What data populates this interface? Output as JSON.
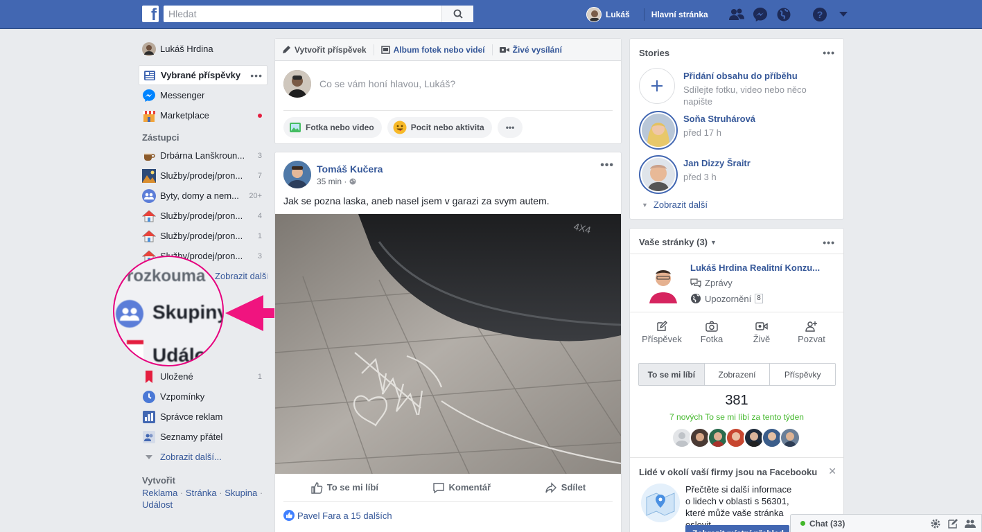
{
  "topbar": {
    "logo": "f",
    "search_placeholder": "Hledat",
    "user_name": "Lukáš",
    "home_label": "Hlavní stránka",
    "icons": [
      "friends-icon",
      "messenger-icon",
      "globe-icon",
      "help-icon",
      "caret-down-icon"
    ]
  },
  "sidebar": {
    "profile_name": "Lukáš Hrdina",
    "main": [
      {
        "label": "Vybrané příspěvky",
        "icon": "news-feed-icon"
      },
      {
        "label": "Messenger",
        "icon": "messenger-icon"
      },
      {
        "label": "Marketplace",
        "icon": "marketplace-icon"
      }
    ],
    "shortcuts_title": "Zástupci",
    "shortcuts": [
      {
        "label": "Drbárna Lanškroun...",
        "count": "3"
      },
      {
        "label": "Služby/prodej/pron...",
        "count": "7"
      },
      {
        "label": "Byty, domy a nem...",
        "count": "20+"
      },
      {
        "label": "Služby/prodej/pron...",
        "count": "4"
      },
      {
        "label": "Služby/prodej/pron...",
        "count": "1"
      },
      {
        "label": "Služby/prodej/pron...",
        "count": "3"
      }
    ],
    "explore_more": "Zobrazit další...",
    "explore": [
      {
        "label": "Uložené",
        "count": "1"
      },
      {
        "label": "Vzpomínky",
        "count": ""
      },
      {
        "label": "Správce reklam",
        "count": ""
      },
      {
        "label": "Seznamy přátel",
        "count": ""
      }
    ],
    "show_more": "Zobrazit další...",
    "create_title": "Vytvořit",
    "create_links": [
      "Reklama",
      "Stránka",
      "Skupina",
      "Událost"
    ],
    "create_sep": " · "
  },
  "magnifier": {
    "line1": "rozkouma",
    "line2": "Skupiny",
    "line3": "Událo"
  },
  "composer": {
    "tabs": [
      "Vytvořit příspěvek",
      "Album fotek nebo videí",
      "Živé vysílání"
    ],
    "placeholder": "Co se vám honí hlavou, Lukáš?",
    "actions": [
      "Fotka nebo video",
      "Pocit nebo aktivita",
      "•••"
    ]
  },
  "post": {
    "author": "Tomáš Kučera",
    "time": "35 min · ",
    "text": "Jak se pozna laska, aneb nasel jsem v garazi za svym autem.",
    "actions": [
      "To se mi líbí",
      "Komentář",
      "Sdílet"
    ],
    "likes": "Pavel Fara a 15 dalších",
    "more": "•••"
  },
  "stories": {
    "title": "Stories",
    "more": "•••",
    "items": [
      {
        "name": "Přidání obsahu do příběhu",
        "sub": "Sdílejte fotku, video nebo něco napište"
      },
      {
        "name": "Soňa Struhárová",
        "sub": "před 17 h"
      },
      {
        "name": "Jan Dizzy Šraitr",
        "sub": "před 3 h"
      }
    ],
    "show_more": "Zobrazit další"
  },
  "pages": {
    "title": "Vaše stránky (3)",
    "more": "•••",
    "page_name": "Lukáš Hrdina Realitní Konzu...",
    "messages": "Zprávy",
    "notifications": "Upozornění",
    "notif_count": "8",
    "tools": [
      "Příspěvek",
      "Fotka",
      "Živě",
      "Pozvat"
    ],
    "tabs": [
      "To se mi líbí",
      "Zobrazení",
      "Příspěvky"
    ],
    "like_count": "381",
    "new_likes": "7 nových To se mi líbí za tento týden",
    "near_title": "Lidé v okolí vaší firmy jsou na Facebooku",
    "near_text": "Přečtěte si další informace o lidech v oblasti s 56301, které může vaše stránka oslovit.",
    "near_button": "Zobrazit místní přehled"
  },
  "chat": {
    "label": "Chat (33)"
  }
}
